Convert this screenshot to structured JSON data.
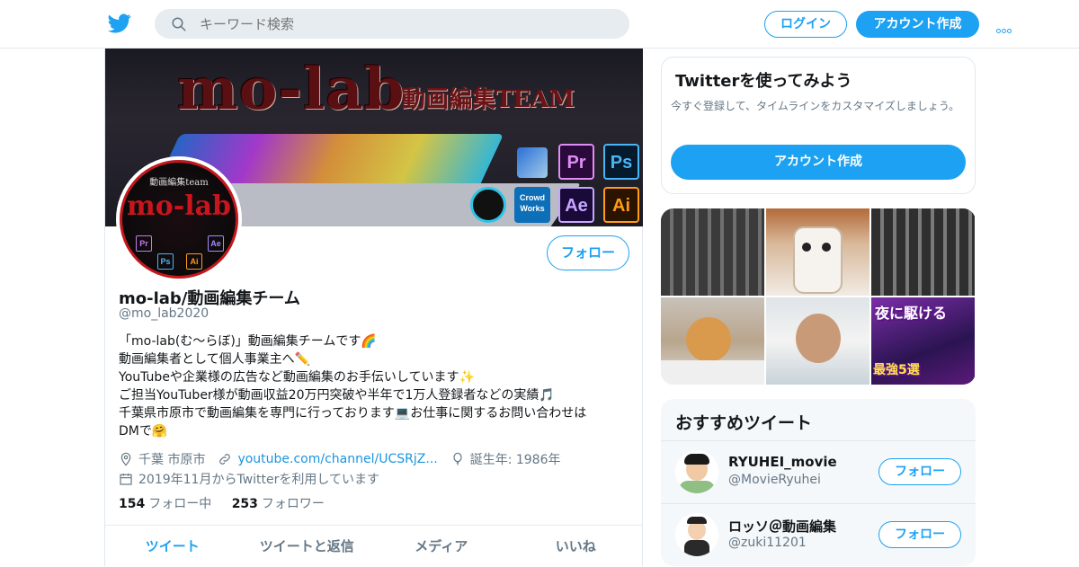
{
  "topbar": {
    "search_placeholder": "キーワード検索",
    "login_label": "ログイン",
    "signup_label": "アカウント作成"
  },
  "banner": {
    "title": "mo-lab",
    "subtitle": "動画編集TEAM",
    "apps": [
      "Pr",
      "Ps",
      "Ae",
      "Ai"
    ],
    "crowdworks_label": "Crowd Works",
    "avatar_top": "動画編集team",
    "avatar_title": "mo-lab"
  },
  "profile": {
    "follow_label": "フォロー",
    "display_name": "mo-lab/動画編集チーム",
    "handle": "@mo_lab2020",
    "bio": [
      "「mo-lab(む～らぼ)」動画編集チームです🌈",
      "動画編集者として個人事業主へ✏️",
      "YouTubeや企業様の広告など動画編集のお手伝いしています✨",
      "ご担当YouTuber様が動画収益20万円突破や半年で1万人登録者などの実績🎵",
      "千葉県市原市で動画編集を専門に行っております💻お仕事に関するお問い合わせは",
      "DMで🤗"
    ],
    "location": "千葉 市原市",
    "url": "youtube.com/channel/UCSRjZ...",
    "birth": "誕生年: 1986年",
    "joined": "2019年11月からTwitterを利用しています",
    "following_count": "154",
    "following_label": "フォロー中",
    "followers_count": "253",
    "followers_label": "フォロワー",
    "tabs": [
      "ツイート",
      "ツイートと返信",
      "メディア",
      "いいね"
    ]
  },
  "try_card": {
    "title": "Twitterを使ってみよう",
    "desc": "今すぐ登録して、タイムラインをカスタマイズしましょう。",
    "button": "アカウント作成"
  },
  "gallery": {
    "text1": "夜に駆ける",
    "text2": "最強5選"
  },
  "recommend": {
    "title": "おすすめツイート",
    "items": [
      {
        "name": "RYUHEI_movie",
        "handle": "@MovieRyuhei",
        "button": "フォロー"
      },
      {
        "name": "ロッソ＠動画編集",
        "handle": "@zuki11201",
        "button": "フォロー"
      }
    ]
  },
  "colors": {
    "accent": "#1da1f2",
    "text_secondary": "#657786",
    "border": "#e1e8ed"
  }
}
